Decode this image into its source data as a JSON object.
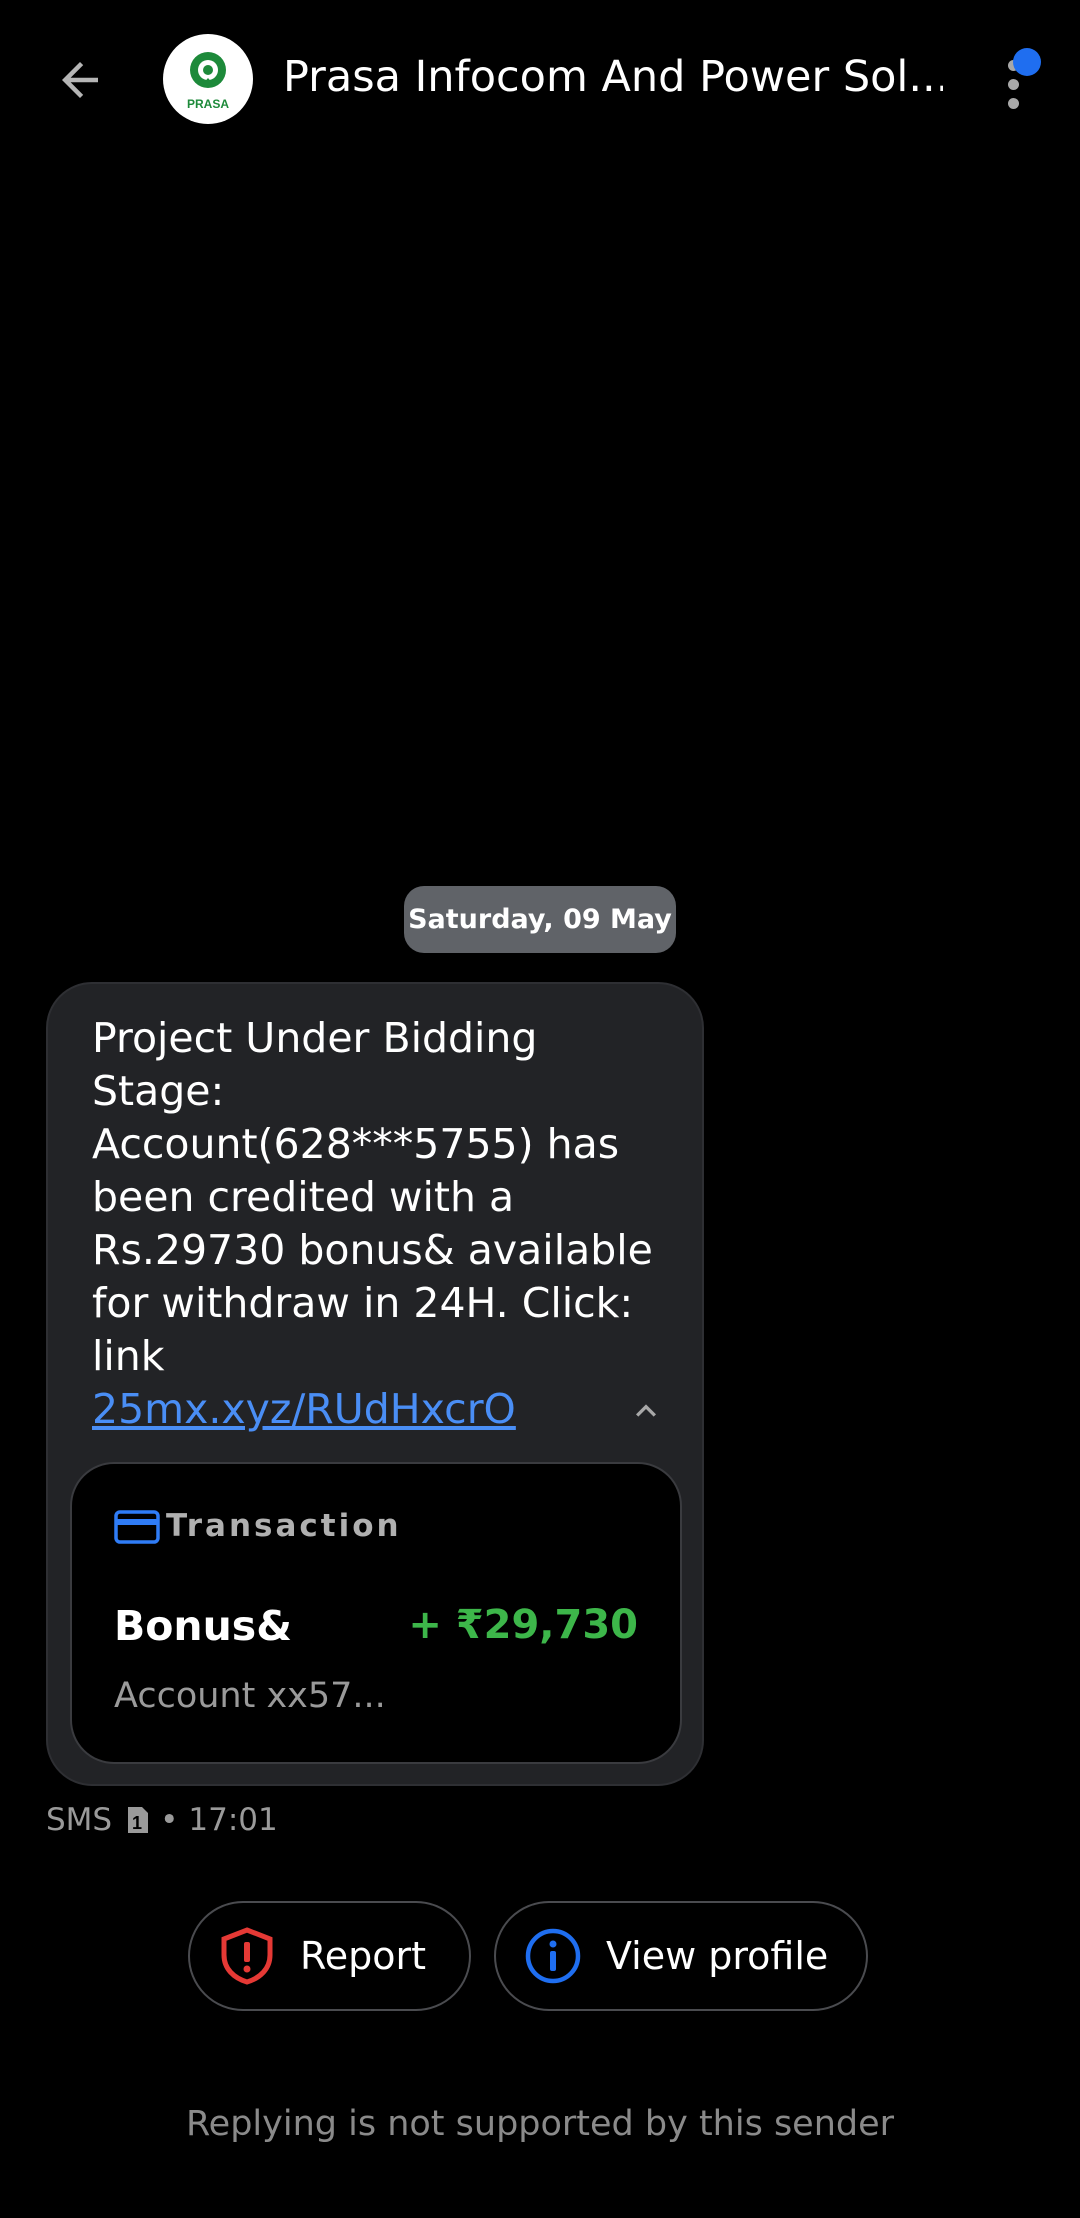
{
  "header": {
    "title": "Prasa Infocom And Power Sol...",
    "avatar_text": "PRASA",
    "back_icon": "arrow-left-icon",
    "more_icon": "more-vertical-icon",
    "notification_color": "#1f6ef0"
  },
  "conversation": {
    "date_label": "Saturday, 09 May",
    "message": {
      "text": "Project Under Bidding Stage: Account(628***5755) has been credited with a Rs.29730 bonus& available for withdraw in 24H. Click: link",
      "link": "25mx.xyz/RUdHxcrO",
      "collapse_icon": "chevron-up-icon",
      "bubble_color": "#222326"
    },
    "transaction_card": {
      "header": "Transaction",
      "icon": "credit-card-icon",
      "name": "Bonus&",
      "amount": "+ ₹29,730",
      "amount_color": "#3db64a",
      "account": "Account xx57..."
    },
    "meta": {
      "channel": "SMS",
      "sim_slot": "1",
      "separator": "•",
      "time": "17:01"
    }
  },
  "actions": {
    "report_label": "Report",
    "report_icon": "shield-alert-icon",
    "report_color": "#e53935",
    "view_profile_label": "View profile",
    "view_profile_icon": "info-icon",
    "view_profile_color": "#1f6ef0"
  },
  "footer": {
    "note": "Replying is not supported by this sender"
  }
}
